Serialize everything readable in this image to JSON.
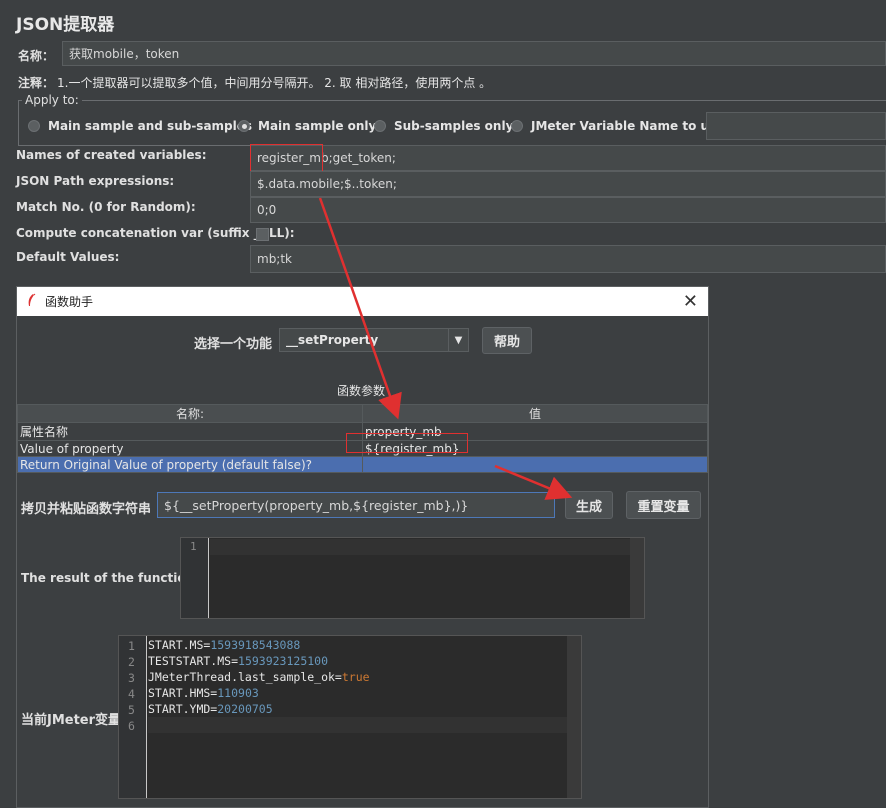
{
  "panel": {
    "title": "JSON提取器",
    "name_label": "名称：",
    "name_value": "获取mobile，token",
    "comment_label": "注释：",
    "comment_value": "1.一个提取器可以提取多个值，中间用分号隔开。 2. 取 相对路径，使用两个点 。",
    "apply_to": {
      "legend": "Apply to:",
      "options": [
        "Main sample and sub-samples",
        "Main sample only",
        "Sub-samples only",
        "JMeter Variable Name to use"
      ],
      "selected_index": 1
    },
    "vars_label": "Names of created variables:",
    "vars_value": "register_mb;get_token;",
    "jsonpath_label": "JSON Path expressions:",
    "jsonpath_value": "$.data.mobile;$..token;",
    "matchno_label": "Match No. (0 for Random):",
    "matchno_value": "0;0",
    "concat_label": "Compute concatenation var (suffix _ALL):",
    "defaults_label": "Default Values:",
    "defaults_value": "mb;tk"
  },
  "dialog": {
    "title": "函数助手",
    "select_label": "选择一个功能",
    "function_value": "__setProperty",
    "help_button": "帮助",
    "params_title": "函数参数",
    "table": {
      "headers": [
        "名称:",
        "值"
      ],
      "rows": [
        {
          "name": "属性名称",
          "value": "property_mb"
        },
        {
          "name": "Value of property",
          "value": "${register_mb}"
        },
        {
          "name": "Return Original Value of property (default false)?",
          "value": ""
        }
      ]
    },
    "copy_label": "拷贝并粘贴函数字符串",
    "function_string": "${__setProperty(property_mb,${register_mb},)}",
    "generate_button": "生成",
    "reset_button": "重置变量",
    "result_label": "The result of the function is",
    "result_lines": [
      "1"
    ],
    "vars_panel_label": "当前JMeter变量",
    "jmeter_vars": [
      {
        "ln": "1",
        "key": "START.MS=",
        "val": "1593918543088",
        "kind": "num"
      },
      {
        "ln": "2",
        "key": "TESTSTART.MS=",
        "val": "1593923125100",
        "kind": "num"
      },
      {
        "ln": "3",
        "key": "JMeterThread.last_sample_ok=",
        "val": "true",
        "kind": "kw"
      },
      {
        "ln": "4",
        "key": "START.HMS=",
        "val": "110903",
        "kind": "num"
      },
      {
        "ln": "5",
        "key": "START.YMD=",
        "val": "20200705",
        "kind": "num"
      },
      {
        "ln": "6",
        "key": "",
        "val": "",
        "kind": "num"
      }
    ]
  },
  "colors": {
    "annotation_red": "#e03030",
    "selection_blue": "#4b6eaf",
    "number": "#6897bb",
    "keyword": "#cc7832"
  }
}
